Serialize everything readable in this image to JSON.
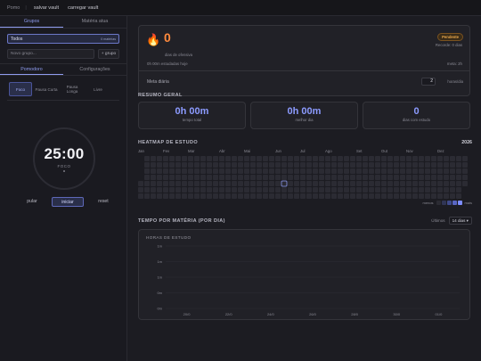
{
  "topbar": {
    "app_name": "Pomo",
    "buttons": [
      "salvar vault",
      "carregar vault"
    ]
  },
  "sidebar": {
    "tabs": [
      {
        "label": "Grupos",
        "active": true
      },
      {
        "label": "Matéria atua",
        "active": false
      }
    ],
    "groups": [
      {
        "label": "Todos",
        "meta": "0 matérias"
      }
    ],
    "new_group_placeholder": "Novo grupo...",
    "add_group_label": "+ grupo",
    "tabs2": [
      {
        "label": "Pomodoro",
        "active": true
      },
      {
        "label": "Configurações",
        "active": false
      }
    ],
    "modes": [
      {
        "label": "Foco",
        "active": true
      },
      {
        "label": "Pausa Curta",
        "active": false
      },
      {
        "label": "Pausa Longa",
        "active": false
      },
      {
        "label": "Livre",
        "active": false
      }
    ],
    "timer": {
      "time": "25:00",
      "phase": "FOCO"
    },
    "controls": {
      "skip": "pular",
      "start": "iniciar",
      "reset": "reset"
    }
  },
  "streak": {
    "days": "0",
    "days_label": "dias de ofensiva",
    "studied_today": "0h 00m estudadas hoje",
    "goal_remaining": "meta: 2h",
    "badge": "Pendente",
    "record": "Recorde: 0 dias",
    "daily_goal_label": "Meta diária",
    "daily_goal_value": "2",
    "daily_goal_unit": "horas/dia"
  },
  "summary": {
    "title": "RESUMO GERAL",
    "stats": [
      {
        "value": "0h 00m",
        "label": "tempo total"
      },
      {
        "value": "0h 00m",
        "label": "melhor dia"
      },
      {
        "value": "0",
        "label": "dias com estudo"
      }
    ]
  },
  "heatmap": {
    "title": "HEATMAP DE ESTUDO",
    "year": "2026",
    "months": [
      "Jan",
      "Fev",
      "Mar",
      "Abr",
      "Mai",
      "Jun",
      "Jul",
      "Ago",
      "Set",
      "Out",
      "Nov",
      "Dez"
    ],
    "legend_less": "menos",
    "legend_more": "mais",
    "colors": [
      "#2b2b33",
      "#303555",
      "#3f4a8a",
      "#5966c4",
      "#7d8cff"
    ]
  },
  "subject_chart": {
    "title": "TEMPO POR MATÉRIA (POR DIA)",
    "range_label": "Últimos",
    "range_value": "14 dias",
    "inner_title": "HORAS DE ESTUDO"
  },
  "chart_data": {
    "type": "bar",
    "title": "HORAS DE ESTUDO",
    "y_tick_labels": [
      "1m",
      "1m",
      "1m",
      "0m",
      "0m"
    ],
    "categories": [
      "20/0",
      "22/0",
      "24/0",
      "26/0",
      "28/0",
      "30/0",
      "01/0"
    ],
    "series": [],
    "grid": true
  }
}
